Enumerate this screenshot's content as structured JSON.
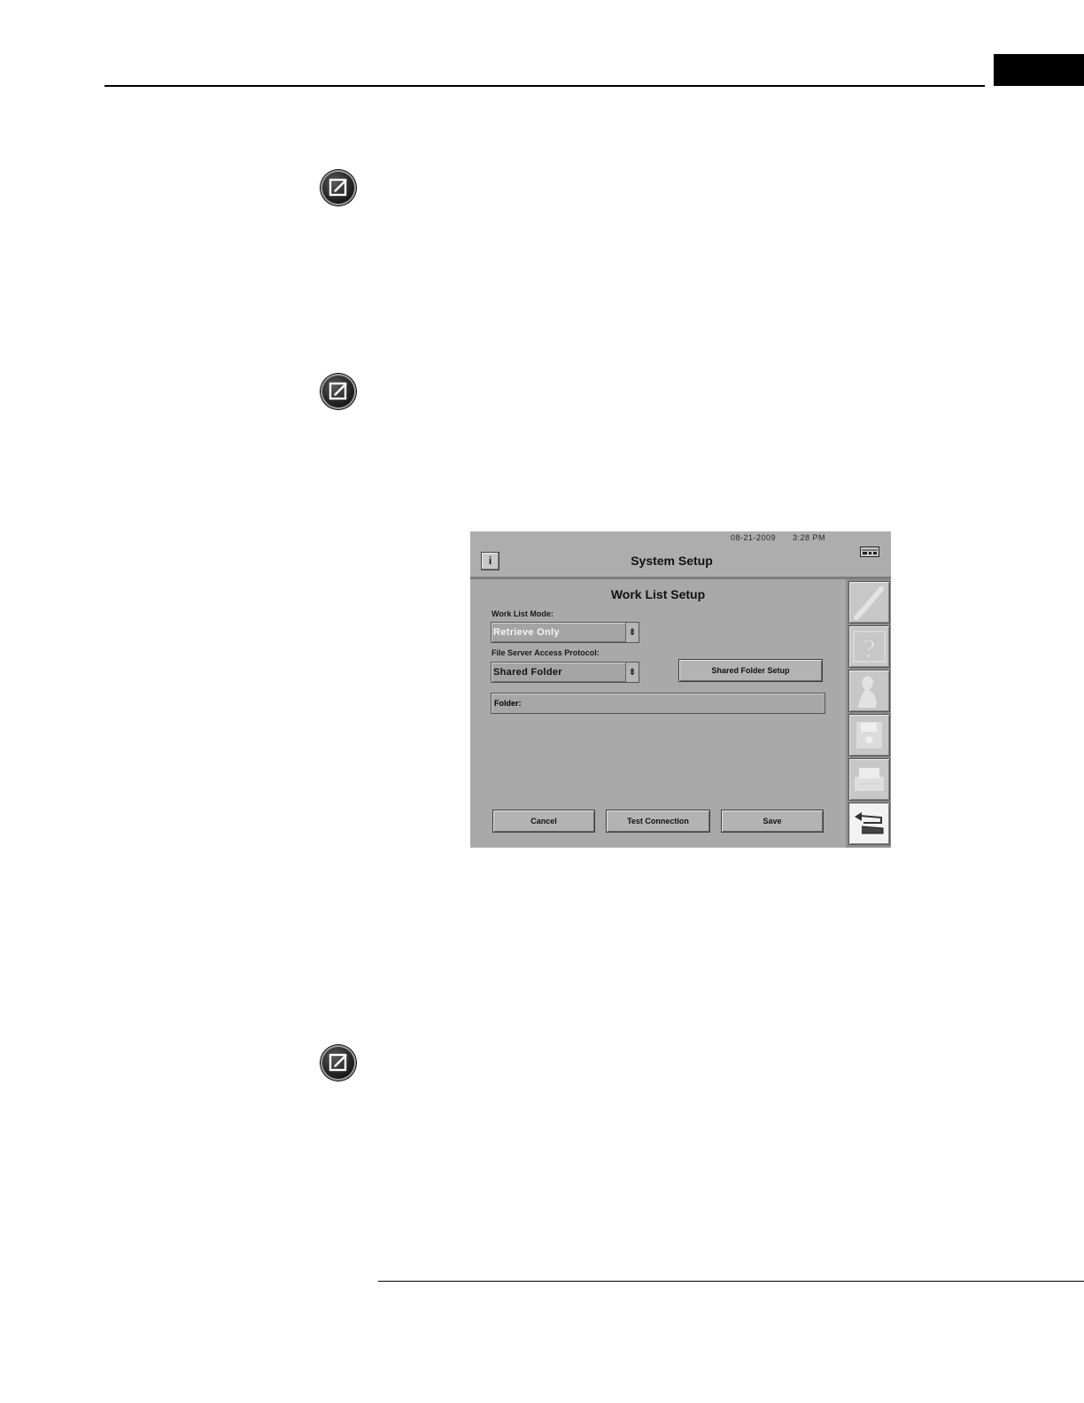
{
  "device_ui": {
    "date": "08-21-2009",
    "time": "3:28 PM",
    "title": "System Setup",
    "info_button_label": "i",
    "panel_title": "Work List Setup",
    "work_list_mode": {
      "label": "Work List Mode:",
      "value": "Retrieve Only"
    },
    "file_server_access_protocol": {
      "label": "File Server Access Protocol:",
      "value": "Shared Folder"
    },
    "shared_folder_setup_label": "Shared Folder Setup",
    "folder_label": "Folder:",
    "buttons": {
      "cancel": "Cancel",
      "test_connection": "Test Connection",
      "save": "Save"
    },
    "side_icons": [
      "tool-icon",
      "help-icon",
      "person-icon",
      "disk-icon",
      "printer-icon",
      "back-arrow-icon"
    ]
  },
  "icons": {
    "note": "note-edit-icon",
    "network": "network-icon",
    "dropdown_arrow": "⇟"
  }
}
